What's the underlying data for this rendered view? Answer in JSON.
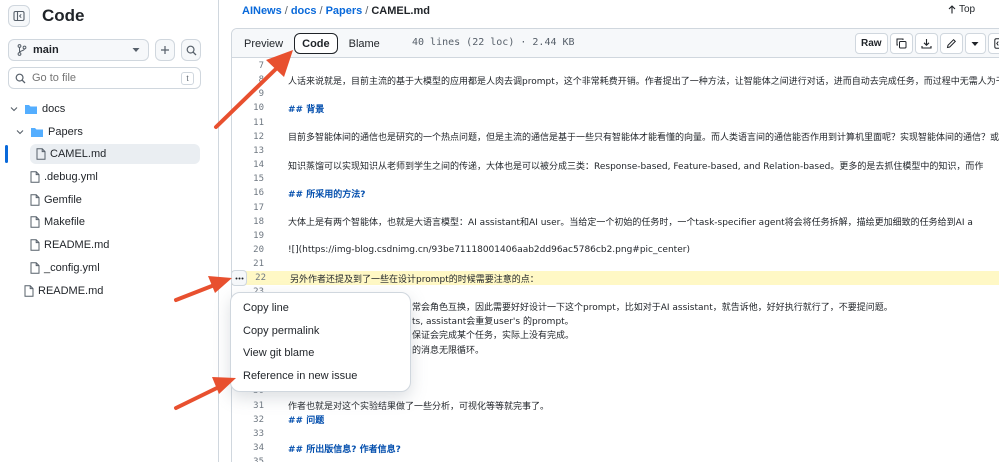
{
  "sidebar": {
    "title": "Code",
    "branch": "main",
    "goto_placeholder": "Go to file",
    "goto_key": "t",
    "tree": [
      {
        "name": "docs",
        "type": "folder-open"
      },
      {
        "name": "Papers",
        "type": "folder-open"
      },
      {
        "name": "CAMEL.md",
        "type": "file",
        "selected": true
      },
      {
        "name": ".debug.yml",
        "type": "file"
      },
      {
        "name": "Gemfile",
        "type": "file"
      },
      {
        "name": "Makefile",
        "type": "file"
      },
      {
        "name": "README.md",
        "type": "file"
      },
      {
        "name": "_config.yml",
        "type": "file"
      },
      {
        "name": "README.md",
        "type": "file"
      }
    ]
  },
  "breadcrumb": {
    "repo": "AINews",
    "p1": "docs",
    "p2": "Papers",
    "file": "CAMEL.md",
    "top": "Top"
  },
  "file": {
    "tabs": {
      "preview": "Preview",
      "code": "Code",
      "blame": "Blame"
    },
    "info": "40 lines (22 loc) · 2.44 KB",
    "raw": "Raw"
  },
  "lines": [
    {
      "n": "7",
      "t": ""
    },
    {
      "n": "8",
      "t": "人话来说就是，目前主流的基于大模型的应用都是人肉去调prompt，这个非常耗费开销。作者提出了一种方法，让智能体之间进行对话，进而自动去完成任务，而过程中无需人为干预。"
    },
    {
      "n": "9",
      "t": ""
    },
    {
      "n": "10",
      "t": "## 背景",
      "h": true
    },
    {
      "n": "11",
      "t": ""
    },
    {
      "n": "12",
      "t": "目前多智能体间的通信也是研究的一个热点问题，但是主流的通信是基于一些只有智能体才能看懂的向量。而人类语言间的通信能否作用到计算机里面呢？实现智能体间的通信？或者更"
    },
    {
      "n": "13",
      "t": ""
    },
    {
      "n": "14",
      "t": "知识蒸馏可以实现知识从老师到学生之间的传递，大体也是可以被分成三类：Response-based, Feature-based, and Relation-based。更多的是去抓住模型中的知识，而作"
    },
    {
      "n": "15",
      "t": ""
    },
    {
      "n": "16",
      "t": "## 所采用的方法?",
      "h": true
    },
    {
      "n": "17",
      "t": ""
    },
    {
      "n": "18",
      "t": "大体上是有两个智能体，也就是大语言模型：AI assistant和AI user。当给定一个初始的任务时，一个task-specifier agent将会将任务拆解，描绘更加细致的任务给到AI a"
    },
    {
      "n": "19",
      "t": ""
    },
    {
      "n": "20",
      "t": "![](https://img-blog.csdnimg.cn/93be71118001406aab2dd96ac5786cb2.png#pic_center)"
    },
    {
      "n": "21",
      "t": ""
    },
    {
      "n": "22",
      "t": "另外作者还提及到了一些在设计prompt的时候需要注意的点：",
      "hl": true
    },
    {
      "n": "23",
      "t": ""
    },
    {
      "n": "24",
      "t": "常会角色互换，因此需要好好设计一下这个prompt，比如对于AI assistant，就告诉他，好好执行就行了，不要提问题。"
    },
    {
      "n": "25",
      "t": "ts, assistant会重复user's 的prompt。"
    },
    {
      "n": "26",
      "t": "保证会完成某个任务，实际上没有完成。"
    },
    {
      "n": "27",
      "t": "的消息无限循环。"
    },
    {
      "n": "28",
      "t": ""
    },
    {
      "n": "29",
      "t": ""
    },
    {
      "n": "30",
      "t": ""
    },
    {
      "n": "31",
      "t": "作者也就是对这个实验结果做了一些分析，可视化等等就完事了。"
    },
    {
      "n": "32",
      "t": "## 问题",
      "h": true
    },
    {
      "n": "33",
      "t": ""
    },
    {
      "n": "34",
      "t": "## 所出版信息? 作者信息?",
      "h": true
    },
    {
      "n": "35",
      "t": ""
    }
  ],
  "menu": {
    "copy_line": "Copy line",
    "copy_permalink": "Copy permalink",
    "view_blame": "View git blame",
    "reference": "Reference in new issue"
  },
  "colors": {
    "accent": "#0969da",
    "arrow": "#e8502f",
    "highlight": "#fff8c5"
  }
}
